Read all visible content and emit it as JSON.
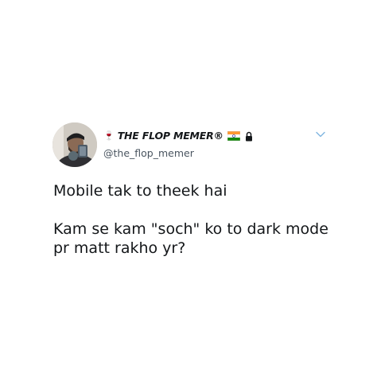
{
  "tweet": {
    "author": {
      "emoji_prefix": "🍷",
      "display_name": "THE FLOP MEMER®",
      "badges": [
        "indian-flag-icon",
        "lock-icon"
      ],
      "handle": "@the_flop_memer",
      "avatar": "profile-photo"
    },
    "menu_icon": "chevron-down-icon",
    "text": {
      "line1": "Mobile tak to theek hai",
      "line2": "Kam se kam \"soch\" ko to dark mode",
      "line3": "pr matt rakho yr?"
    }
  },
  "colors": {
    "background": "#ffffff",
    "text": "#14171a",
    "secondary_text": "#4a5560",
    "caret": "#7fb5e0"
  }
}
